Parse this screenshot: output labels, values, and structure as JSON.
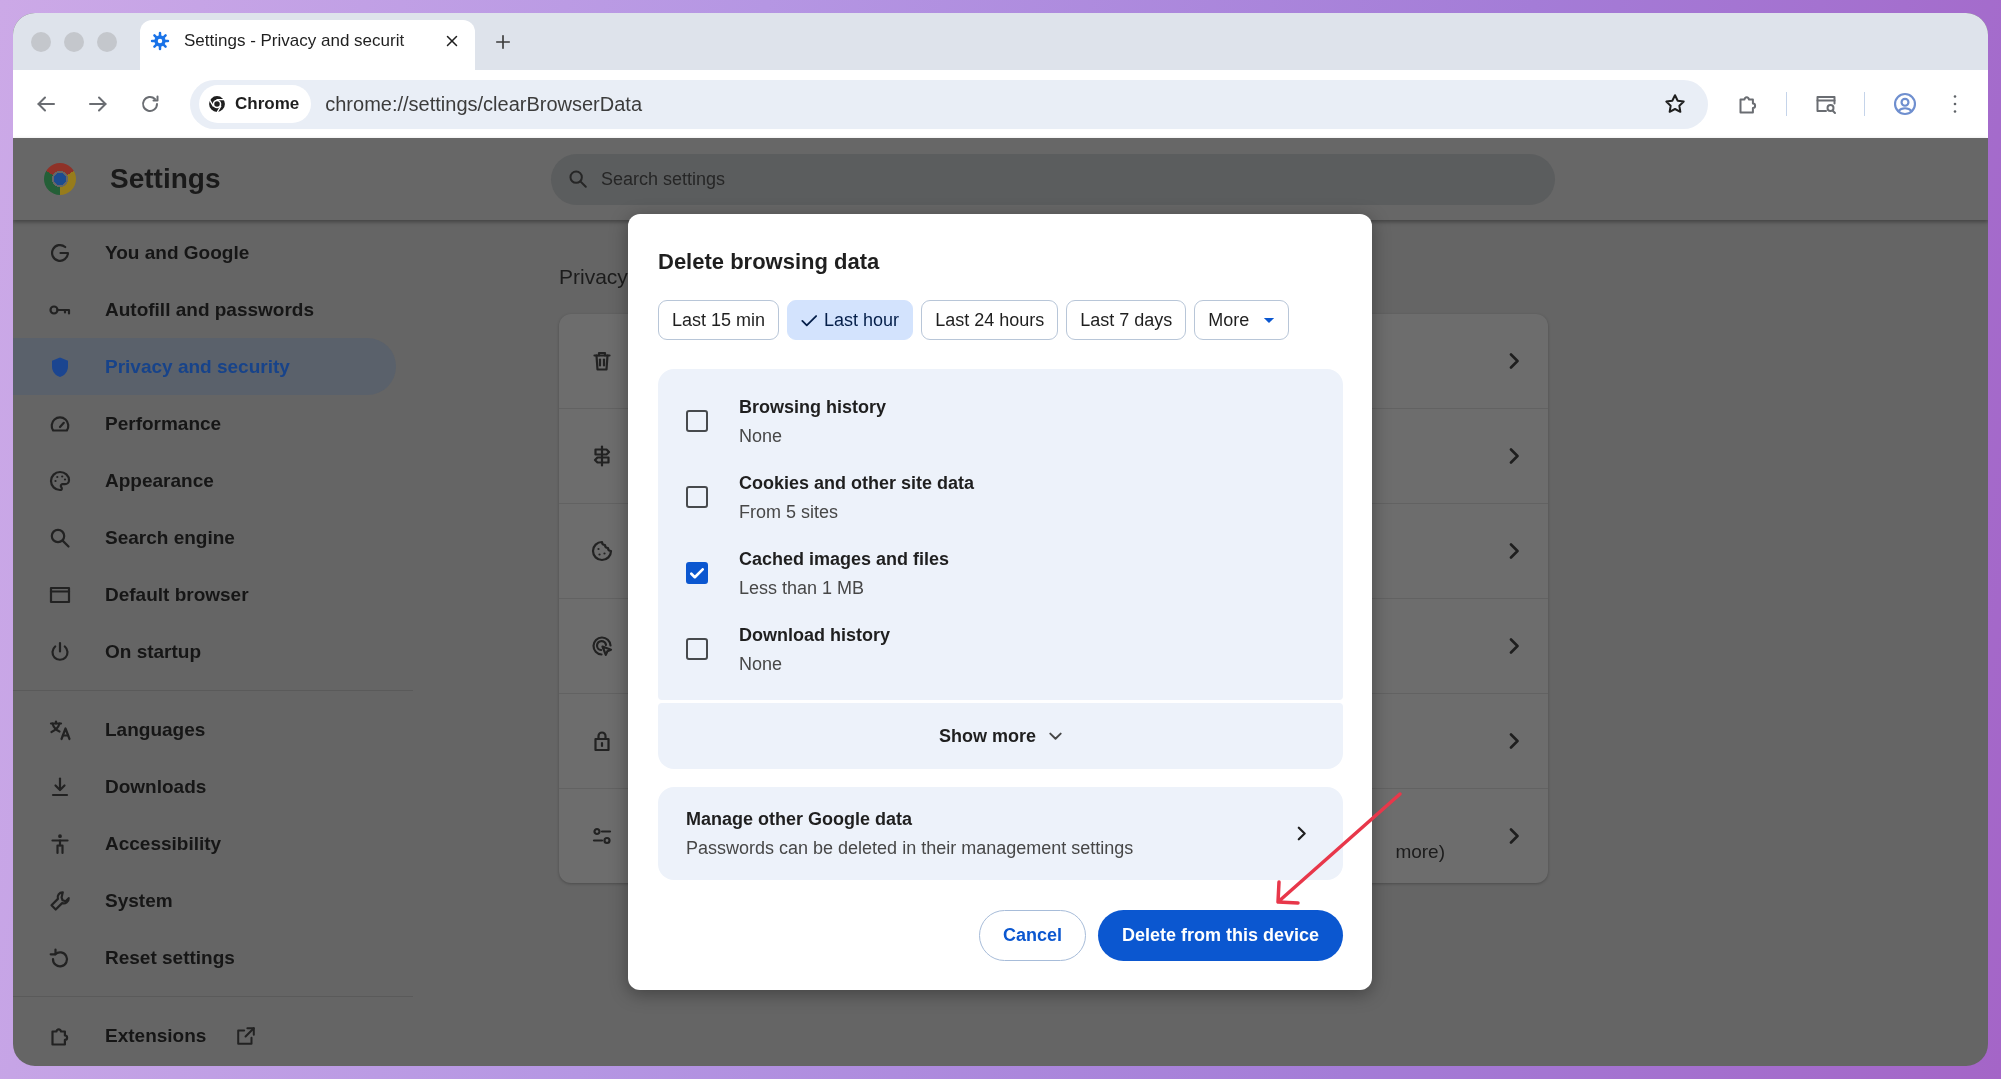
{
  "browser": {
    "tabs": [
      {
        "title": "Settings - Privacy and securit",
        "selected": true
      }
    ],
    "address_bar": {
      "chip": "Chrome",
      "url": "chrome://settings/clearBrowserData"
    }
  },
  "settings_header": {
    "title": "Settings",
    "search": {
      "placeholder": "Search settings"
    }
  },
  "sidebar": {
    "sections": [
      {
        "items": [
          {
            "label": "You and Google",
            "selected": false,
            "external": false
          },
          {
            "label": "Autofill and passwords",
            "selected": false,
            "external": false
          },
          {
            "label": "Privacy and security",
            "selected": true,
            "external": false
          },
          {
            "label": "Performance",
            "selected": false,
            "external": false
          },
          {
            "label": "Appearance",
            "selected": false,
            "external": false
          },
          {
            "label": "Search engine",
            "selected": false,
            "external": false
          },
          {
            "label": "Default browser",
            "selected": false,
            "external": false
          },
          {
            "label": "On startup",
            "selected": false,
            "external": false
          }
        ]
      },
      {
        "items": [
          {
            "label": "Languages",
            "selected": false,
            "external": false
          },
          {
            "label": "Downloads",
            "selected": false,
            "external": false
          },
          {
            "label": "Accessibility",
            "selected": false,
            "external": false
          },
          {
            "label": "System",
            "selected": false,
            "external": false
          },
          {
            "label": "Reset settings",
            "selected": false,
            "external": false
          }
        ]
      },
      {
        "items": [
          {
            "label": "Extensions",
            "selected": false,
            "external": true
          }
        ]
      }
    ]
  },
  "content": {
    "heading": "Privacy",
    "rows": [
      {
        "chevron": true
      },
      {
        "chevron": true
      },
      {
        "chevron": true
      },
      {
        "chevron": true
      },
      {
        "chevron": true
      },
      {
        "chevron": true,
        "description": "more)"
      }
    ]
  },
  "dialog": {
    "title": "Delete browsing data",
    "time_ranges": [
      {
        "label": "Last 15 min",
        "kind": "option",
        "selected": false
      },
      {
        "label": "Last hour",
        "kind": "option",
        "selected": true
      },
      {
        "label": "Last 24 hours",
        "kind": "option",
        "selected": false
      },
      {
        "label": "Last 7 days",
        "kind": "option",
        "selected": false
      },
      {
        "label": "More",
        "kind": "dropdown",
        "selected": false
      }
    ],
    "data_types": [
      {
        "label": "Browsing history",
        "detail": "None",
        "checked": false
      },
      {
        "label": "Cookies and other site data",
        "detail": "From 5 sites",
        "checked": false
      },
      {
        "label": "Cached images and files",
        "detail": "Less than 1 MB",
        "checked": true
      },
      {
        "label": "Download history",
        "detail": "None",
        "checked": false
      }
    ],
    "show_more": "Show more",
    "other_data": {
      "title": "Manage other Google data",
      "subtitle": "Passwords can be deleted in their management settings"
    },
    "buttons": [
      {
        "label": "Cancel",
        "kind": "secondary"
      },
      {
        "label": "Delete from this device",
        "kind": "primary"
      }
    ]
  },
  "annotations": [
    {
      "kind": "arrow"
    }
  ]
}
